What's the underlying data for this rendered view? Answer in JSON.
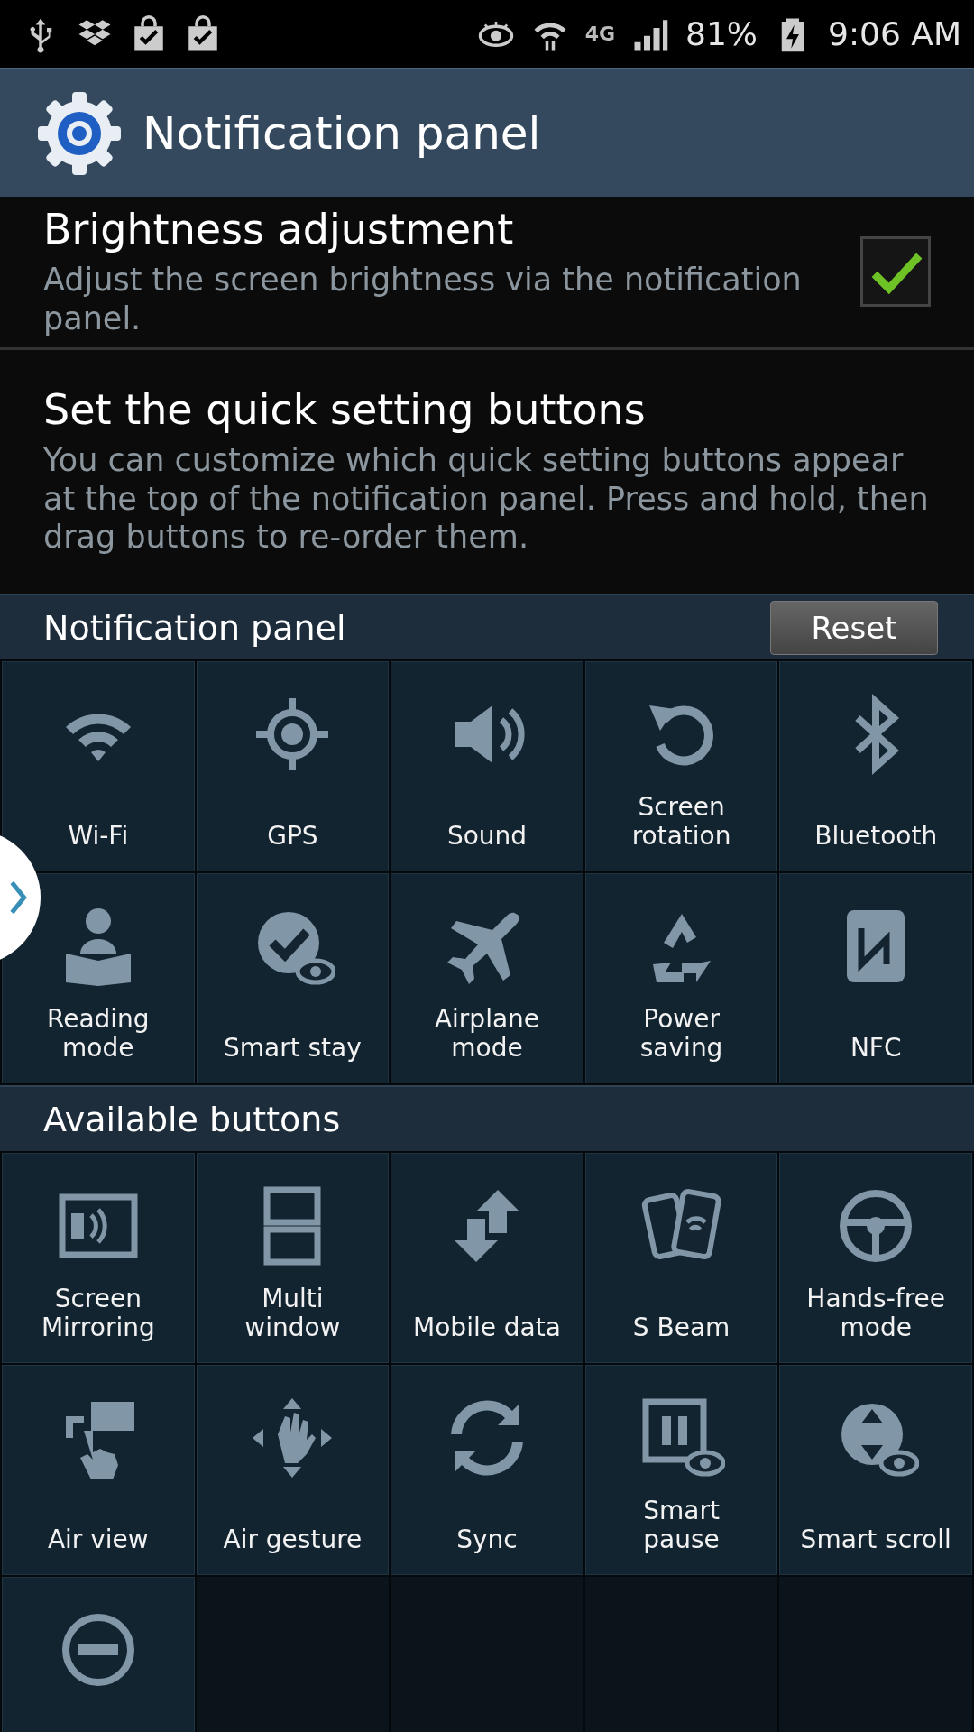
{
  "status_bar": {
    "network": "4G",
    "battery": "81%",
    "time": "9:06 AM"
  },
  "title_bar": {
    "title": "Notification panel"
  },
  "settings": [
    {
      "kind": "checkbox",
      "title": "Brightness adjustment",
      "summary": "Adjust the screen brightness via the notification panel.",
      "checked": true
    },
    {
      "kind": "info",
      "title": "Set the quick setting buttons",
      "summary": "You can customize which quick setting buttons appear at the top of the notification panel. Press and hold, then drag buttons to re-order them."
    }
  ],
  "notification_panel": {
    "header": "Notification panel",
    "reset_button": "Reset",
    "buttons": [
      {
        "kind": "labeled",
        "label": "Wi-Fi"
      },
      {
        "kind": "labeled",
        "label": "GPS"
      },
      {
        "kind": "labeled",
        "label": "Sound"
      },
      {
        "kind": "labeled",
        "label": "Screen rotation"
      },
      {
        "kind": "labeled",
        "label": "Bluetooth"
      },
      {
        "kind": "labeled",
        "label": "Reading mode"
      },
      {
        "kind": "labeled",
        "label": "Smart stay"
      },
      {
        "kind": "labeled",
        "label": "Airplane mode"
      },
      {
        "kind": "labeled",
        "label": "Power saving"
      },
      {
        "kind": "labeled",
        "label": "NFC"
      }
    ]
  },
  "available_buttons": {
    "header": "Available buttons",
    "buttons": [
      {
        "kind": "labeled",
        "label": "Screen Mirroring"
      },
      {
        "kind": "labeled",
        "label": "Multi window"
      },
      {
        "kind": "labeled",
        "label": "Mobile data"
      },
      {
        "kind": "labeled",
        "label": "S Beam"
      },
      {
        "kind": "labeled",
        "label": "Hands-free mode"
      },
      {
        "kind": "labeled",
        "label": "Air view"
      },
      {
        "kind": "labeled",
        "label": "Air gesture"
      },
      {
        "kind": "labeled",
        "label": "Sync"
      },
      {
        "kind": "labeled",
        "label": "Smart pause"
      },
      {
        "kind": "labeled",
        "label": "Smart scroll"
      },
      {
        "kind": "icon_only"
      }
    ]
  }
}
